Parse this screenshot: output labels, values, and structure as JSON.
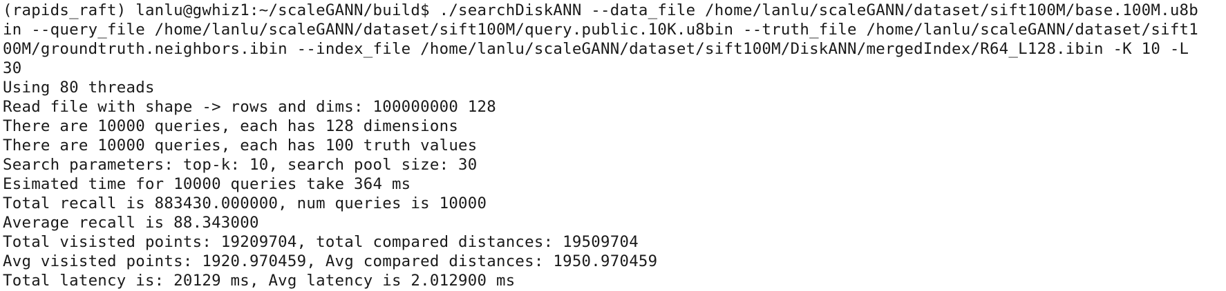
{
  "terminal": {
    "lines": [
      "(rapids_raft) lanlu@gwhiz1:~/scaleGANN/build$ ./searchDiskANN --data_file /home/lanlu/scaleGANN/dataset/sift100M/base.100M.u8b",
      "in --query_file /home/lanlu/scaleGANN/dataset/sift100M/query.public.10K.u8bin --truth_file /home/lanlu/scaleGANN/dataset/sift1",
      "00M/groundtruth.neighbors.ibin --index_file /home/lanlu/scaleGANN/dataset/sift100M/DiskANN/mergedIndex/R64_L128.ibin -K 10 -L",
      "30",
      "Using 80 threads",
      "Read file with shape -> rows and dims: 100000000 128",
      "There are 10000 queries, each has 128 dimensions",
      "There are 10000 queries, each has 100 truth values",
      "Search parameters: top-k: 10, search pool size: 30",
      "Esimated time for 10000 queries take 364 ms",
      "Total recall is 883430.000000, num queries is 10000",
      "Average recall is 88.343000",
      "Total visisted points: 19209704, total compared distances: 19509704",
      "Avg visisted points: 1920.970459, Avg compared distances: 1950.970459",
      "Total latency is: 20129 ms, Avg latency is 2.012900 ms"
    ]
  }
}
